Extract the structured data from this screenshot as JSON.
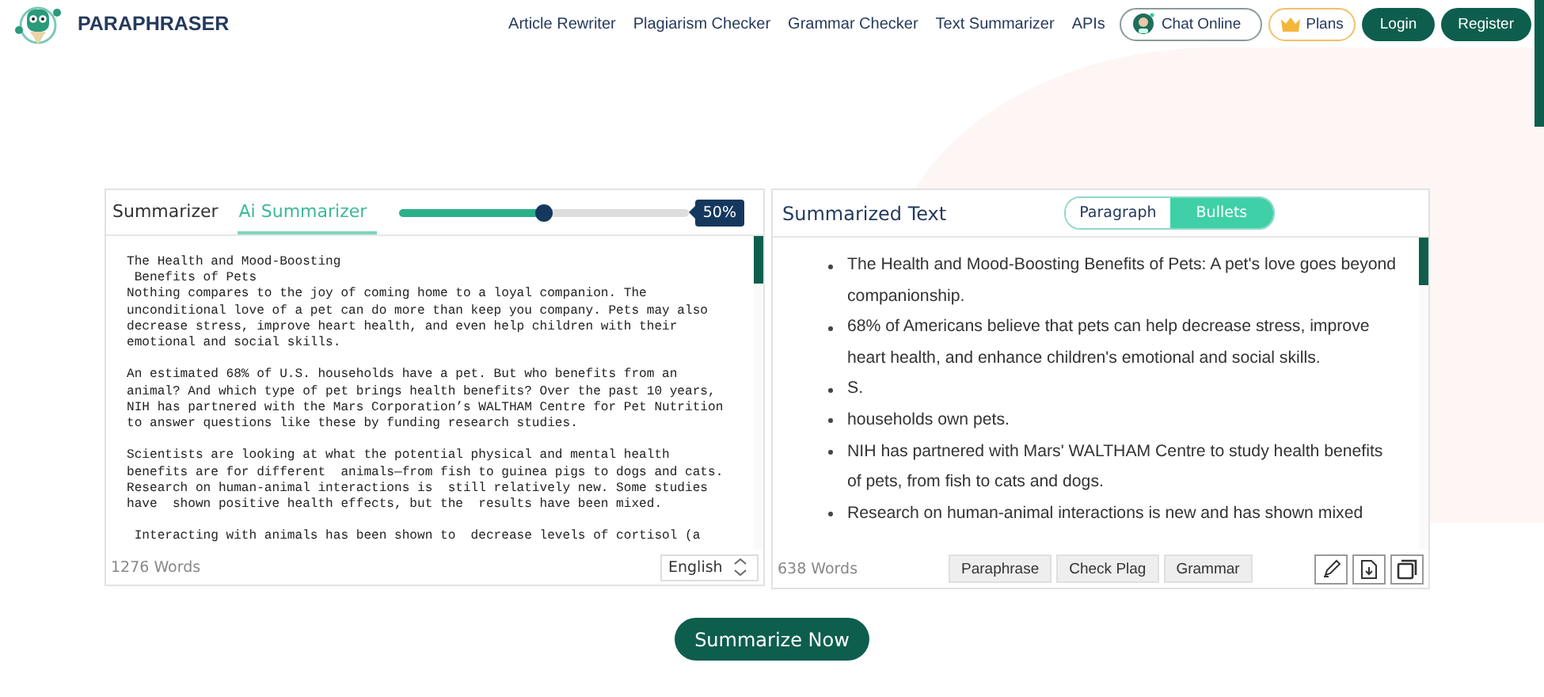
{
  "header": {
    "brand": "PARAPHRASER",
    "nav": [
      "Article Rewriter",
      "Plagiarism Checker",
      "Grammar Checker",
      "Text Summarizer",
      "APIs"
    ],
    "chat": "Chat Online",
    "plans": "Plans",
    "login": "Login",
    "register": "Register"
  },
  "input_panel": {
    "tabs": [
      {
        "label": "Summarizer",
        "selected": false
      },
      {
        "label": "Ai Summarizer",
        "selected": true
      }
    ],
    "length": {
      "level": 0.5,
      "reading": "50%"
    },
    "paragraphs": [
      [
        "The Health and Mood-Boosting",
        " Benefits of Pets",
        "Nothing compares to the joy of coming home to a loyal companion. The",
        "unconditional love of a pet can do more than keep you company. Pets may also",
        "decrease stress, improve heart health, and even help children with their",
        "emotional and social skills."
      ],
      [
        "An estimated 68% of U.S. households have a pet. But who benefits from an",
        "animal? And which type of pet brings health benefits? Over the past 10 years,",
        "NIH has partnered with the Mars Corporation’s WALTHAM Centre for Pet Nutrition",
        "to answer questions like these by funding research studies."
      ],
      [
        "Scientists are looking at what the potential physical and mental health",
        "benefits are for different  animals—from fish to guinea pigs to dogs and cats.",
        "Research on human-animal interactions is  still relatively new. Some studies",
        "have  shown positive health effects, but the  results have been mixed."
      ],
      [
        " Interacting with animals has been shown to  decrease levels of cortisol (a"
      ]
    ],
    "word_count": "1276 Words",
    "language": "English"
  },
  "output_panel": {
    "title": "Summarized Text",
    "modes": [
      {
        "label": "Paragraph",
        "selected": false
      },
      {
        "label": "Bullets",
        "selected": true
      }
    ],
    "bullets": [
      "The Health and Mood-Boosting Benefits of Pets: A pet's love goes beyond companionship.",
      "68% of Americans believe that pets can help decrease stress, improve heart health, and enhance children's emotional and social skills.",
      "S.",
      "households own pets.",
      "NIH has partnered with Mars' WALTHAM Centre to study health benefits of pets, from fish to cats and dogs.",
      "Research on human-animal interactions is new and has shown mixed"
    ],
    "word_count": "638 Words",
    "actions": [
      "Paraphrase",
      "Check Plag",
      "Grammar"
    ]
  },
  "submit": "Summarize Now"
}
